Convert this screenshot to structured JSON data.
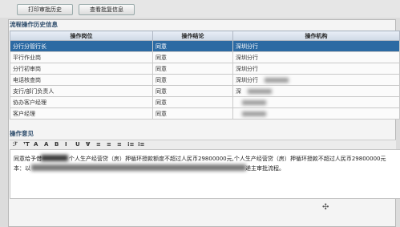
{
  "toolbar": {
    "print_button": "打印审批历史",
    "view_button": "查看批复信息"
  },
  "history": {
    "title": "流程操作历史信息",
    "columns": [
      "操作岗位",
      "操作结论",
      "操作机构"
    ],
    "rows": [
      {
        "post": "分行分管行长",
        "result": "同意",
        "org": "深圳分行",
        "selected": true
      },
      {
        "post": "平行作业岗",
        "result": "同意",
        "org": "深圳分行",
        "selected": false
      },
      {
        "post": "分行初审岗",
        "result": "同意",
        "org": "深圳分行",
        "selected": false
      },
      {
        "post": "电话核查岗",
        "result": "同意",
        "org": "深圳分行",
        "selected": false
      },
      {
        "post": "支行/部门负责人",
        "result": "同意",
        "org": "深",
        "selected": false
      },
      {
        "post": "协办客户经理",
        "result": "同意",
        "org": "",
        "selected": false
      },
      {
        "post": "客户经理",
        "result": "同意",
        "org": "",
        "selected": false
      }
    ]
  },
  "opinion": {
    "title": "操作意见",
    "toolbar_items": [
      "ℱ",
      "ᵀT",
      "A",
      "A",
      "B",
      "I",
      "U",
      "Ɐ",
      "≡",
      "≡",
      "≡",
      "⁝≡",
      "⁝≡"
    ],
    "line1": "同意给予借",
    "line1b": "个人生产经营贷（房）押循环授款额度不超过人民币29800000元,个人生产经营贷（房）押循环授款不超过人民币29800000元",
    "line2": "本：以",
    "line2b": "递主审批流程。"
  }
}
